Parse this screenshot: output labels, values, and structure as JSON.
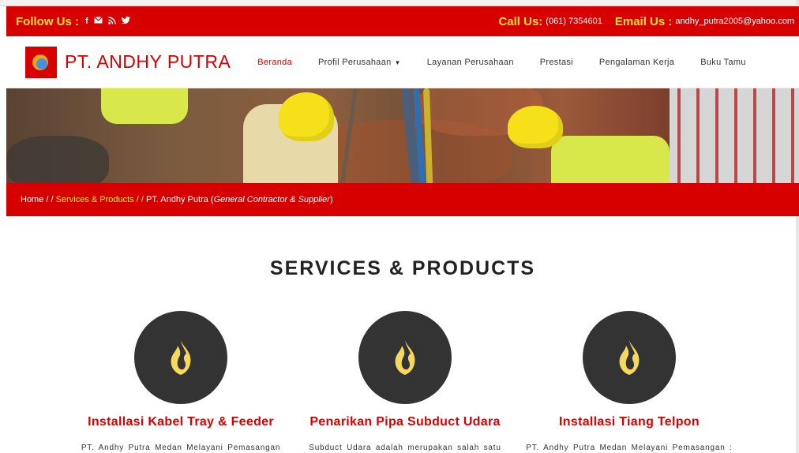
{
  "topbar": {
    "follow_label": "Follow Us :",
    "social": [
      {
        "icon": "facebook-icon",
        "glyph": "f"
      },
      {
        "icon": "mail-icon",
        "glyph": "✉"
      },
      {
        "icon": "rss-icon",
        "glyph": "℘"
      },
      {
        "icon": "twitter-icon",
        "glyph": "❧"
      }
    ],
    "call_label": "Call Us:",
    "phone": "(061) 7354601",
    "email_label": "Email Us :",
    "email": "andhy_putra2005@yahoo.com"
  },
  "navbar": {
    "brand": "PT. ANDHY PUTRA",
    "menu": [
      {
        "label": "Beranda",
        "active": true
      },
      {
        "label": "Profil Perusahaan",
        "dropdown": true
      },
      {
        "label": "Layanan Perusahaan"
      },
      {
        "label": "Prestasi"
      },
      {
        "label": "Pengalaman Kerja"
      },
      {
        "label": "Buku Tamu"
      }
    ],
    "caret": "▼"
  },
  "breadcrumb": {
    "home": "Home / /",
    "services": "Services & Products / /",
    "company": "PT. Andhy Putra (",
    "tagline": "General Contractor & Supplier",
    "close": ")"
  },
  "section": {
    "title": "SERVICES & PRODUCTS"
  },
  "cards": [
    {
      "icon": "flame-icon",
      "title": "Installasi Kabel Tray & Feeder",
      "text": "PT. Andhy Putra Medan Melayani Pemasangan"
    },
    {
      "icon": "flame-icon",
      "title": "Penarikan Pipa Subduct Udara",
      "text": "Subduct Udara adalah merupakan salah satu"
    },
    {
      "icon": "flame-icon",
      "title": "Installasi Tiang Telpon",
      "text": "PT. Andhy Putra Medan Melayani Pemasangan :"
    }
  ],
  "colors": {
    "brand_red": "#d60000",
    "accent_yellow": "#ffe033",
    "icon_circle": "#333333",
    "flame": "#f7d85e"
  }
}
